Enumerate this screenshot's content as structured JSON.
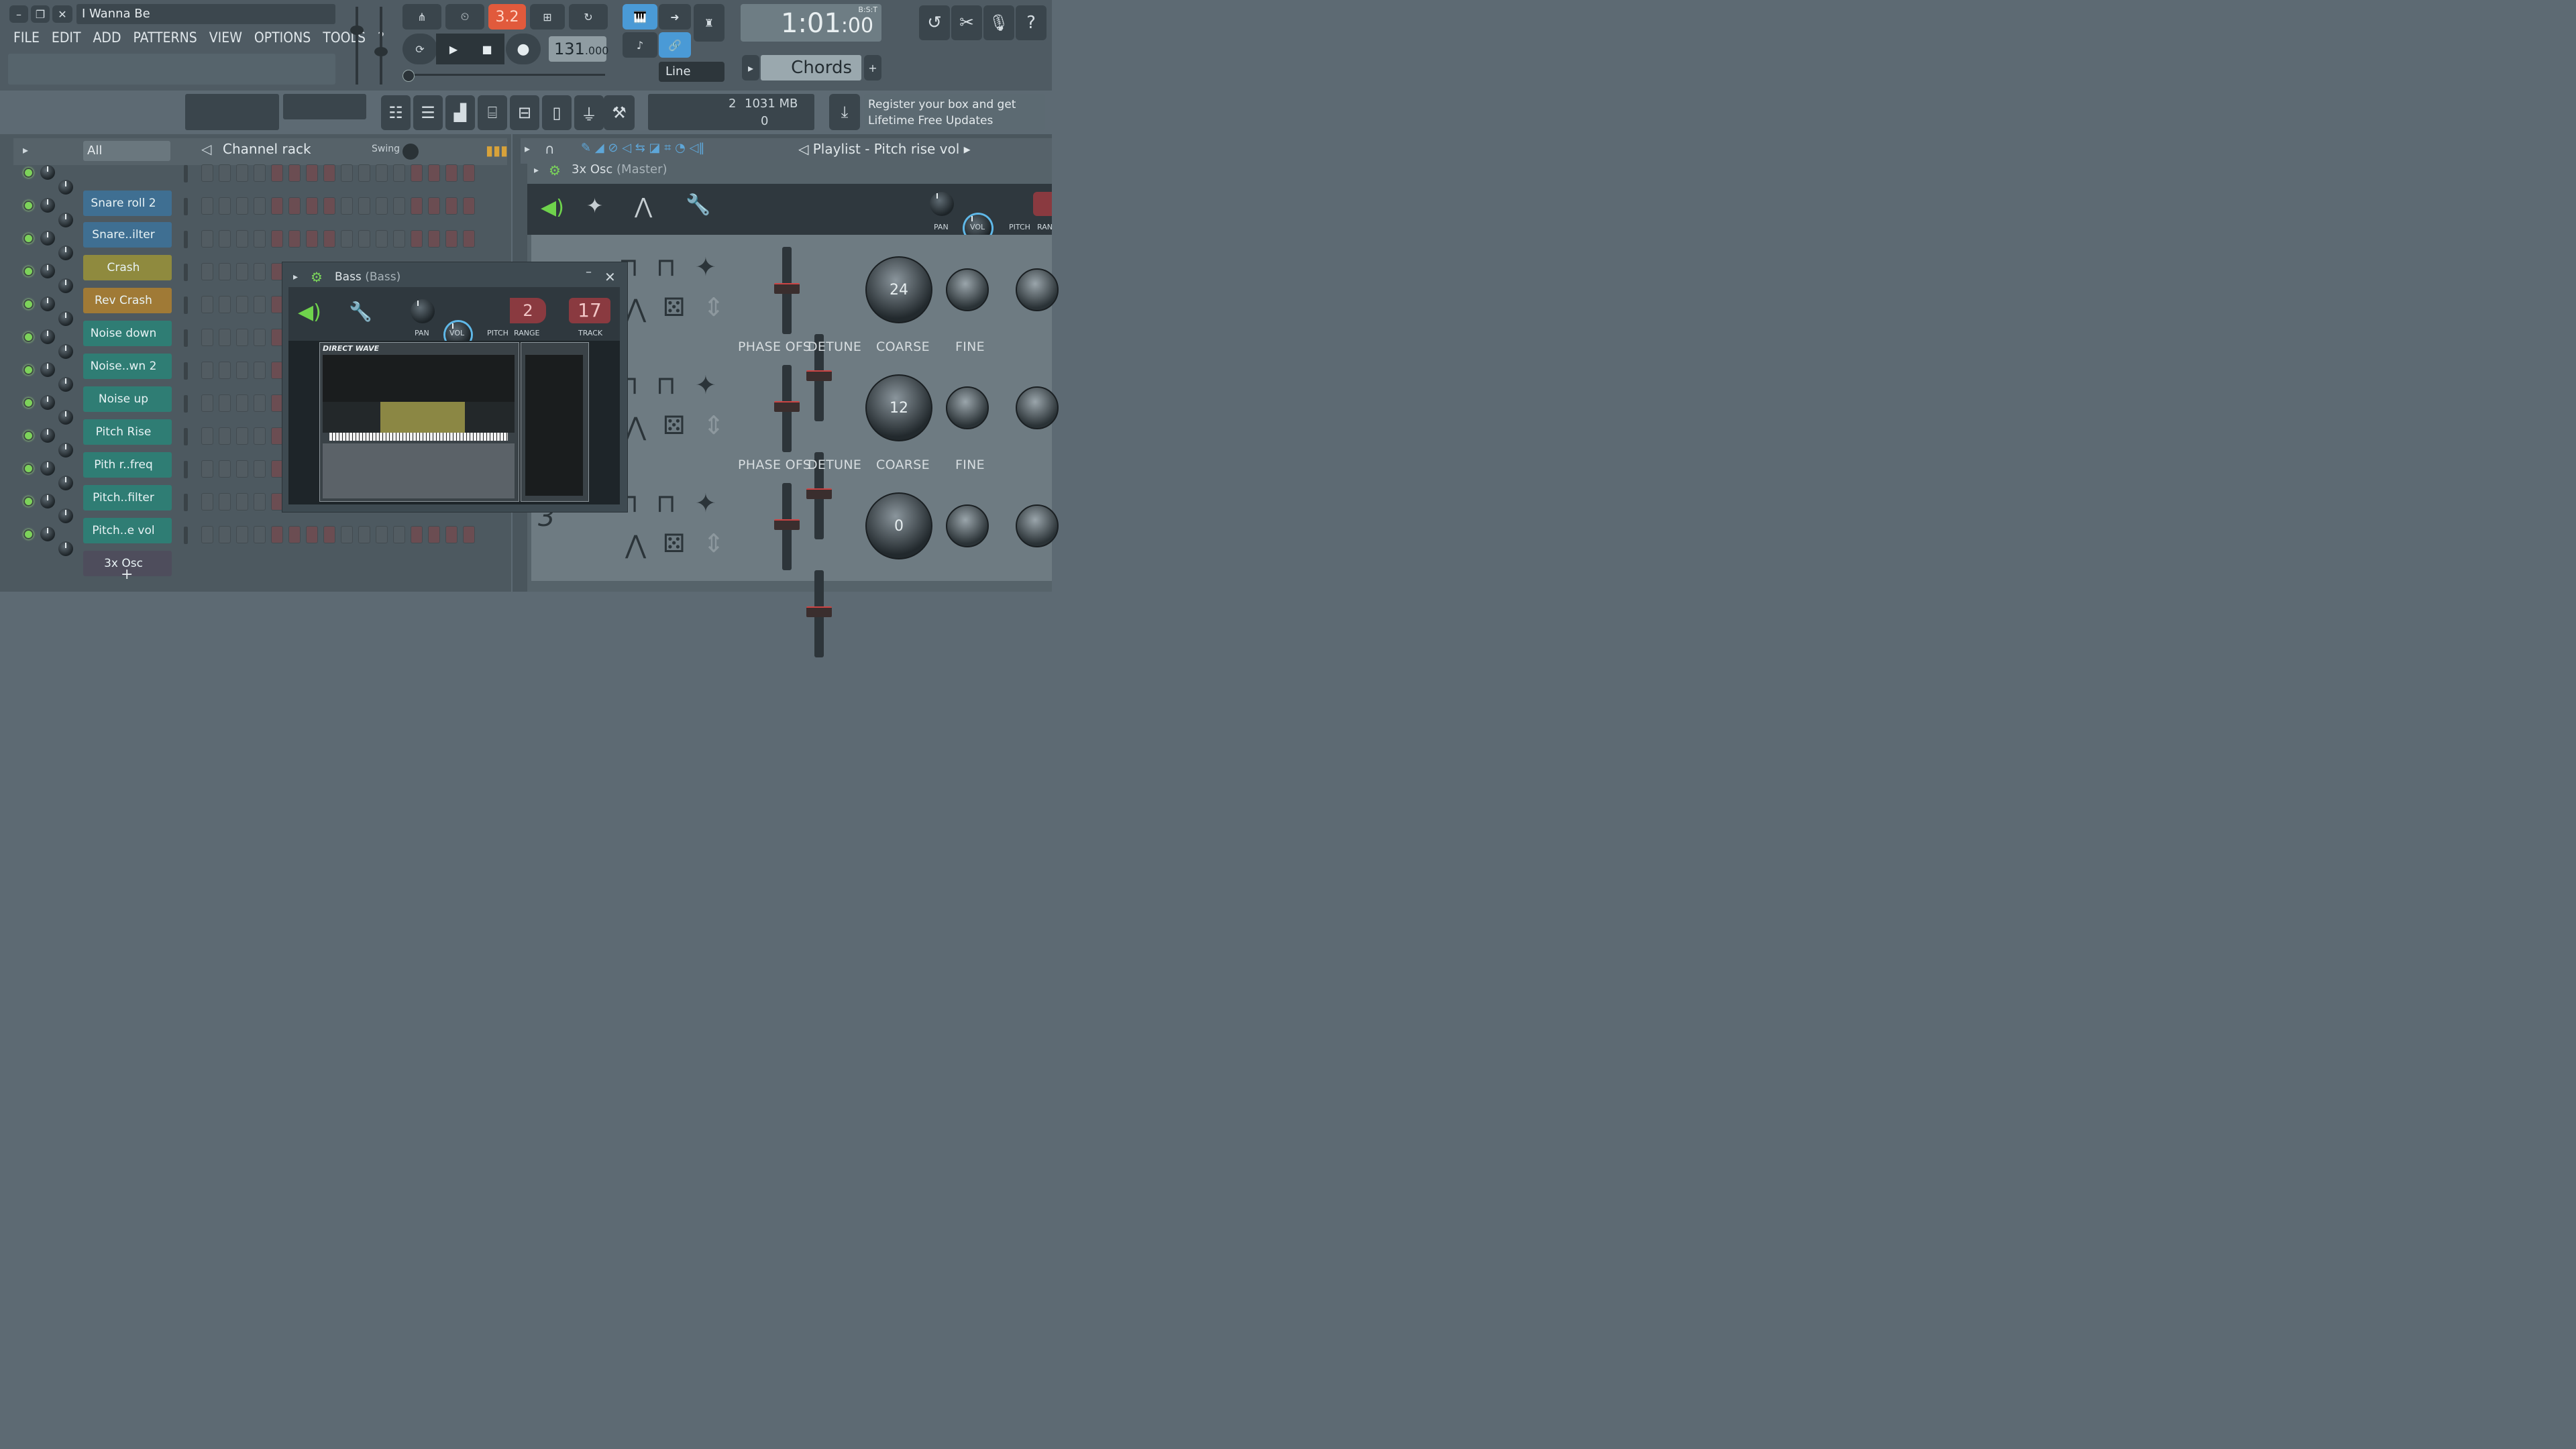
{
  "window": {
    "title": "I Wanna Be"
  },
  "menu": [
    "FILE",
    "EDIT",
    "ADD",
    "PATTERNS",
    "VIEW",
    "OPTIONS",
    "TOOLS",
    "?"
  ],
  "transport": {
    "pattern_mode": "3.2",
    "tempo_main": "131",
    "tempo_frac": ".000",
    "time_main": "1:01",
    "time_frac": ":00",
    "time_label": "B:S:T"
  },
  "snap": {
    "value": "Line"
  },
  "pattern": {
    "name": "Chords"
  },
  "memory": {
    "value1": "2",
    "mb": "1031 MB",
    "value2": "0"
  },
  "news": {
    "line1": "Register your box and get",
    "line2": "Lifetime Free Updates"
  },
  "channel_rack": {
    "filter": "All",
    "title": "Channel rack",
    "swing_label": "Swing",
    "channels": [
      {
        "name": "Snare roll 2",
        "color": "#3f6f92"
      },
      {
        "name": "Snare..ilter",
        "color": "#3f6f92"
      },
      {
        "name": "Crash",
        "color": "#8f8a3e"
      },
      {
        "name": "Rev Crash",
        "color": "#a07a36"
      },
      {
        "name": "Noise down",
        "color": "#2f7d74"
      },
      {
        "name": "Noise..wn 2",
        "color": "#2f7d74"
      },
      {
        "name": "Noise up",
        "color": "#2f7d74"
      },
      {
        "name": "Pitch Rise",
        "color": "#2f7d74"
      },
      {
        "name": "Pith r..freq",
        "color": "#2f7d74"
      },
      {
        "name": "Pitch..filter",
        "color": "#2f7d74"
      },
      {
        "name": "Pitch..e vol",
        "color": "#2f7d74"
      },
      {
        "name": "3x Osc",
        "color": "#4e4d5c"
      }
    ],
    "add_label": "+"
  },
  "playlist": {
    "title": "Playlist - Pitch rise vol"
  },
  "osc": {
    "title": "3x Osc",
    "subtitle": "(Master)",
    "pan": "PAN",
    "vol": "VOL",
    "pitch": "PITCH",
    "range": "RAN",
    "rows": [
      {
        "coarse": "24"
      },
      {
        "coarse": "12"
      },
      {
        "coarse": "0"
      }
    ],
    "phase_label": "PHASE OFS",
    "detune_label": "DETUNE",
    "coarse_label": "COARSE",
    "fine_label": "FINE",
    "osc_number": "3"
  },
  "bass": {
    "title": "Bass",
    "subtitle": "(Bass)",
    "pan": "PAN",
    "vol": "VOL",
    "pitch": "PITCH",
    "range": "RANGE",
    "track": "TRACK",
    "range_value": "2",
    "track_value": "17",
    "plugin_name": "DIRECT WAVE"
  }
}
